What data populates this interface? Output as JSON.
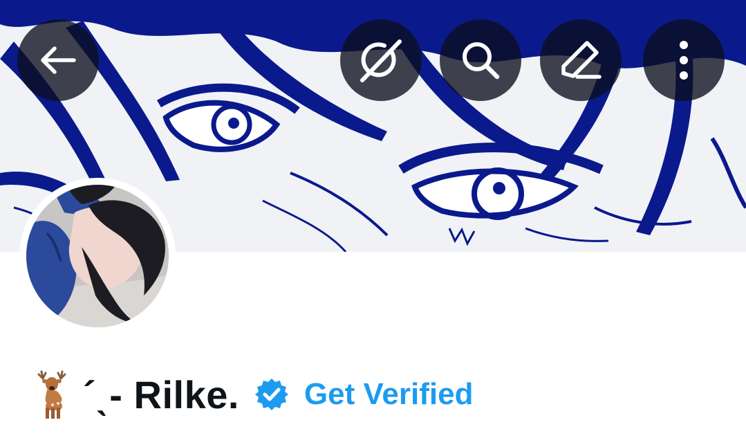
{
  "profile": {
    "display_name": "´ˎ- Rilke.",
    "get_verified_label": "Get Verified"
  },
  "header": {
    "buttons": [
      {
        "name": "back",
        "icon": "arrow-left-icon"
      },
      {
        "name": "grok",
        "icon": "grok-icon"
      },
      {
        "name": "search",
        "icon": "search-icon"
      },
      {
        "name": "edit",
        "icon": "pencil-icon"
      },
      {
        "name": "more",
        "icon": "more-vertical-icon"
      }
    ]
  },
  "icons": {
    "name_emoji": "deer-icon",
    "badge": "verified-badge-icon"
  },
  "colors": {
    "accent_blue": "#1d9bf0",
    "banner_ink": "#0a1a8c",
    "text": "#0f1419",
    "button_bg": "#0c101e"
  }
}
